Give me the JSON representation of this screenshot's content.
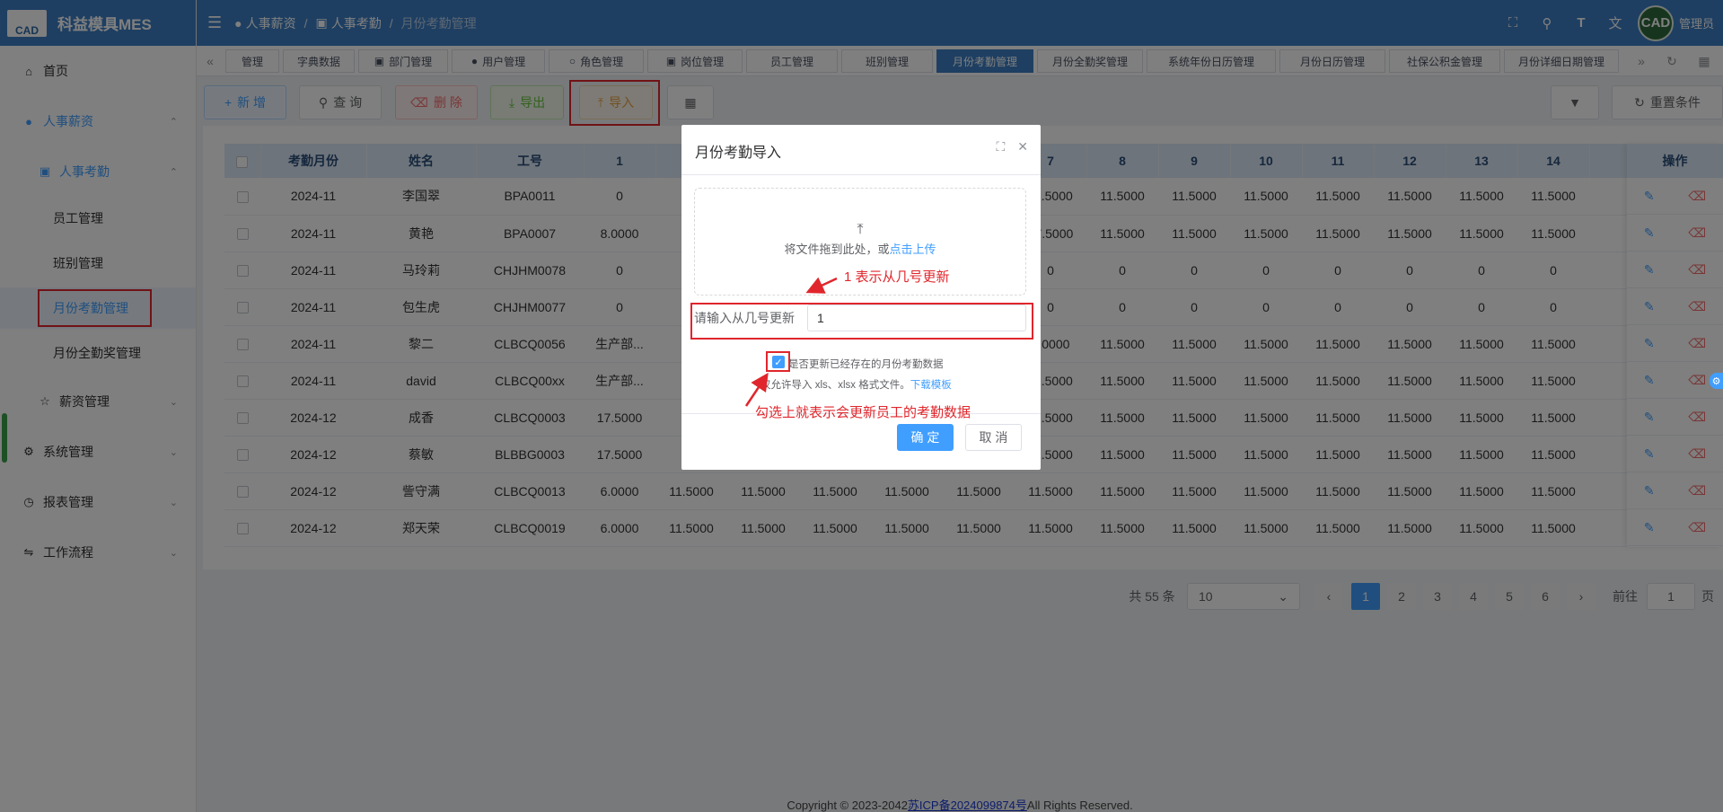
{
  "app": {
    "title": "科益模具MES",
    "logo_text": "CAD"
  },
  "sidebar": {
    "items": [
      {
        "label": "首页",
        "icon": "home-icon"
      },
      {
        "label": "人事薪资",
        "icon": "user-icon"
      },
      {
        "label": "人事考勤",
        "icon": "badge-icon"
      },
      {
        "label": "员工管理"
      },
      {
        "label": "班别管理"
      },
      {
        "label": "月份考勤管理"
      },
      {
        "label": "月份全勤奖管理"
      },
      {
        "label": "薪资管理",
        "icon": "trophy-icon"
      },
      {
        "label": "系统管理",
        "icon": "gear-icon"
      },
      {
        "label": "报表管理",
        "icon": "clock-icon"
      },
      {
        "label": "工作流程",
        "icon": "flow-icon"
      }
    ]
  },
  "header": {
    "breadcrumb": [
      "人事薪资",
      "人事考勤",
      "月份考勤管理"
    ],
    "user": "管理员",
    "avatar_text": "CAD"
  },
  "tabs": [
    "管理",
    "字典数据",
    "部门管理",
    "用户管理",
    "角色管理",
    "岗位管理",
    "员工管理",
    "班别管理",
    "月份考勤管理",
    "月份全勤奖管理",
    "系统年份日历管理",
    "月份日历管理",
    "社保公积金管理",
    "月份详细日期管理"
  ],
  "toolbar": {
    "add": "新 增",
    "query": "查 询",
    "delete": "删 除",
    "export": "导出",
    "import": "导入",
    "reset": "重置条件"
  },
  "table": {
    "columns": [
      "考勤月份",
      "姓名",
      "工号",
      "1",
      "",
      "",
      "",
      "",
      "",
      "7",
      "8",
      "9",
      "10",
      "11",
      "12",
      "13",
      "14"
    ],
    "rows": [
      [
        "2024-11",
        "李国翠",
        "BPA0011",
        "0",
        "",
        "",
        "",
        "",
        "",
        "11.5000",
        "11.5000",
        "11.5000",
        "11.5000",
        "11.5000",
        "11.5000",
        "11.5000",
        "11.5000"
      ],
      [
        "2024-11",
        "黄艳",
        "BPA0007",
        "8.0000",
        "",
        "",
        "",
        "",
        "",
        "17.5000",
        "11.5000",
        "11.5000",
        "11.5000",
        "11.5000",
        "11.5000",
        "11.5000",
        "11.5000"
      ],
      [
        "2024-11",
        "马玲莉",
        "CHJHM0078",
        "0",
        "",
        "",
        "",
        "",
        "",
        "0",
        "0",
        "0",
        "0",
        "0",
        "0",
        "0",
        "0"
      ],
      [
        "2024-11",
        "包生虎",
        "CHJHM0077",
        "0",
        "",
        "",
        "",
        "",
        "",
        "0",
        "0",
        "0",
        "0",
        "0",
        "0",
        "0",
        "0"
      ],
      [
        "2024-11",
        "黎二",
        "CLBCQ0056",
        "生产部...",
        "",
        "",
        "",
        "",
        "",
        "8.0000",
        "11.5000",
        "11.5000",
        "11.5000",
        "11.5000",
        "11.5000",
        "11.5000",
        "11.5000"
      ],
      [
        "2024-11",
        "david",
        "CLBCQ00xx",
        "生产部...",
        "",
        "",
        "",
        "",
        "",
        "11.5000",
        "11.5000",
        "11.5000",
        "11.5000",
        "11.5000",
        "11.5000",
        "11.5000",
        "11.5000"
      ],
      [
        "2024-12",
        "成香",
        "CLBCQ0003",
        "17.5000",
        "",
        "",
        "",
        "",
        "",
        "11.5000",
        "11.5000",
        "11.5000",
        "11.5000",
        "11.5000",
        "11.5000",
        "11.5000",
        "11.5000"
      ],
      [
        "2024-12",
        "蔡敏",
        "BLBBG0003",
        "17.5000",
        "",
        "",
        "",
        "",
        "",
        "11.5000",
        "11.5000",
        "11.5000",
        "11.5000",
        "11.5000",
        "11.5000",
        "11.5000",
        "11.5000"
      ],
      [
        "2024-12",
        "訾守满",
        "CLBCQ0013",
        "6.0000",
        "11.5000",
        "11.5000",
        "11.5000",
        "11.5000",
        "11.5000",
        "11.5000",
        "11.5000",
        "11.5000",
        "11.5000",
        "11.5000",
        "11.5000",
        "11.5000",
        "11.5000"
      ],
      [
        "2024-12",
        "郑天荣",
        "CLBCQ0019",
        "6.0000",
        "11.5000",
        "11.5000",
        "11.5000",
        "11.5000",
        "11.5000",
        "11.5000",
        "11.5000",
        "11.5000",
        "11.5000",
        "11.5000",
        "11.5000",
        "11.5000",
        "11.5000"
      ]
    ],
    "op_header": "操作"
  },
  "pagination": {
    "total": "共 55 条",
    "page_size": "10",
    "pages": [
      "1",
      "2",
      "3",
      "4",
      "5",
      "6"
    ],
    "goto_label": "前往",
    "goto_value": "1",
    "page_unit": "页"
  },
  "dialog": {
    "title": "月份考勤导入",
    "drop_text": "将文件拖到此处，或",
    "upload_link": "点击上传",
    "from_day_label": "请输入从几号更新",
    "from_day_value": "1",
    "update_checkbox": "是否更新已经存在的月份考勤数据",
    "file_hint": "仅允许导入 xls、xlsx 格式文件。",
    "template_link": "下载模板",
    "confirm": "确 定",
    "cancel": "取 消"
  },
  "annotations": {
    "day_note": "1 表示从几号更新",
    "check_note": "勾选上就表示会更新员工的考勤数据"
  },
  "footer": {
    "prefix": "Copyright © 2023-2042",
    "icp": "苏ICP备2024099874号",
    "suffix": "All Rights Reserved."
  },
  "colors": {
    "primary": "#3c7ec4",
    "accent": "#409eff",
    "danger": "#f56c6c",
    "annotation": "#e0262c"
  }
}
